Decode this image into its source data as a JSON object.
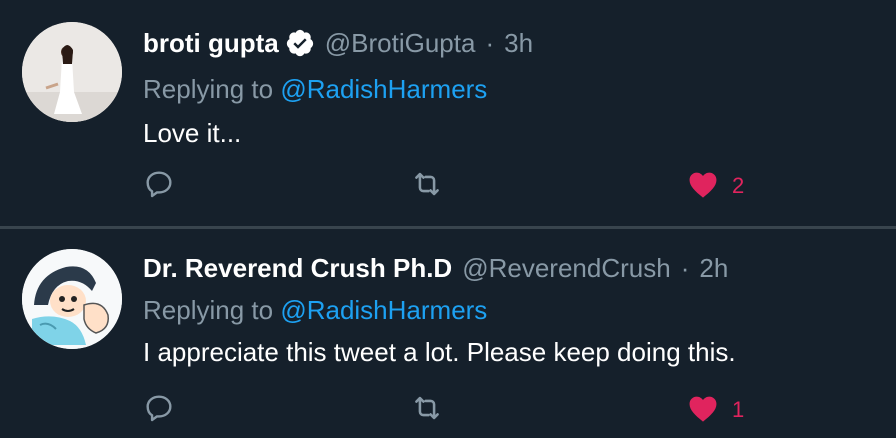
{
  "tweets": [
    {
      "display_name": "broti gupta",
      "verified": true,
      "handle": "@BrotiGupta",
      "separator": "·",
      "time": "3h",
      "replying_prefix": "Replying to",
      "replying_to": "@RadishHarmers",
      "text": "Love it...",
      "likes": "2",
      "liked": true
    },
    {
      "display_name": "Dr. Reverend Crush Ph.D",
      "verified": false,
      "handle": "@ReverendCrush",
      "separator": "·",
      "time": "2h",
      "replying_prefix": "Replying to",
      "replying_to": "@RadishHarmers",
      "text": "I appreciate this tweet a lot. Please keep doing this.",
      "likes": "1",
      "liked": true
    }
  ],
  "colors": {
    "background": "#15202b",
    "divider": "#38444d",
    "secondary_text": "#8899a6",
    "link": "#1da1f2",
    "like": "#e0245e"
  },
  "icons": {
    "verified": "verified-badge-icon",
    "reply": "reply-icon",
    "retweet": "retweet-icon",
    "like": "heart-icon"
  }
}
